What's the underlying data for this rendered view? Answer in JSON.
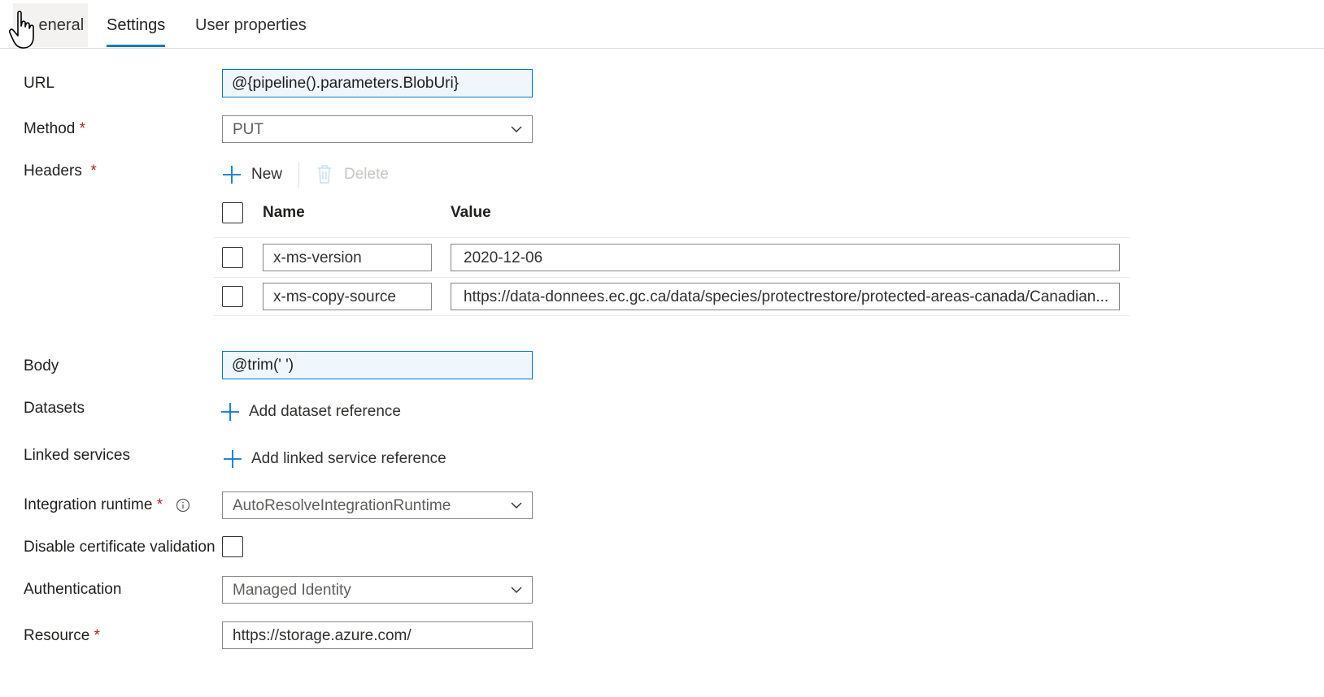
{
  "tabs": [
    {
      "label": "General"
    },
    {
      "label": "Settings"
    },
    {
      "label": "User properties"
    }
  ],
  "form": {
    "url": {
      "label": "URL",
      "value": "@{pipeline().parameters.BlobUri}"
    },
    "method": {
      "label": "Method",
      "required_mark": "*",
      "value": "PUT"
    },
    "headers": {
      "label": "Headers",
      "required_mark": "*",
      "new_label": "New",
      "delete_label": "Delete",
      "col_name": "Name",
      "col_value": "Value",
      "rows": [
        {
          "name": "x-ms-version",
          "value": "2020-12-06"
        },
        {
          "name": "x-ms-copy-source",
          "value": "https://data-donnees.ec.gc.ca/data/species/protectrestore/protected-areas-canada/Canadian..."
        }
      ]
    },
    "body": {
      "label": "Body",
      "value": "@trim(' ')"
    },
    "datasets": {
      "label": "Datasets",
      "action": "Add dataset reference"
    },
    "linked_services": {
      "label": "Linked services",
      "action": "Add linked service reference"
    },
    "integration_runtime": {
      "label": "Integration runtime",
      "required_mark": "*",
      "value": "AutoResolveIntegrationRuntime"
    },
    "disable_cert": {
      "label": "Disable certificate validation",
      "checked": false
    },
    "authentication": {
      "label": "Authentication",
      "value": "Managed Identity"
    },
    "resource": {
      "label": "Resource",
      "required_mark": "*",
      "value": "https://storage.azure.com/"
    }
  },
  "colors": {
    "accent": "#0078d4",
    "required": "#a4262c",
    "expression_bg": "#eff6fc"
  }
}
